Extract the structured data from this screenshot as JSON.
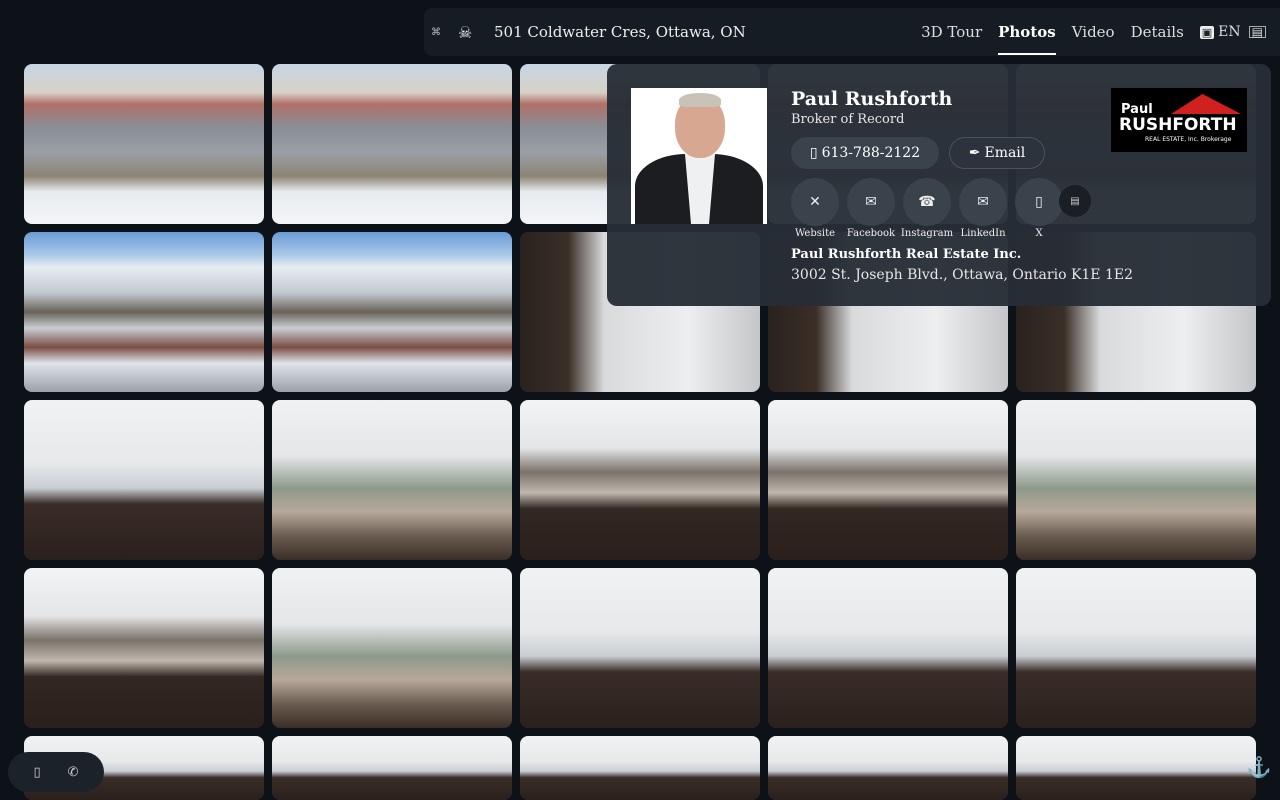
{
  "topbar": {
    "address": "501 Coldwater Cres, Ottawa, ON",
    "tabs": [
      "3D Tour",
      "Photos",
      "Video",
      "Details"
    ],
    "active_tab": "Photos",
    "language": "EN"
  },
  "gallery": {
    "rows": 5,
    "columns": 5
  },
  "agent": {
    "name": "Paul Rushforth",
    "title": "Broker of Record",
    "phone": "613-788-2122",
    "email_label": "Email",
    "socials": [
      {
        "label": "Website",
        "icon": "close-icon"
      },
      {
        "label": "Facebook",
        "icon": "facebook-icon"
      },
      {
        "label": "Instagram",
        "icon": "phone-icon"
      },
      {
        "label": "LinkedIn",
        "icon": "linkedin-icon"
      },
      {
        "label": "X",
        "icon": "mobile-icon"
      }
    ],
    "company": "Paul Rushforth Real Estate Inc.",
    "company_address": "3002 St. Joseph Blvd., Ottawa, Ontario K1E 1E2",
    "logo": {
      "line1": "Paul",
      "line2": "RUSHFORTH",
      "line3": "REAL ESTATE, Inc. Brokerage"
    }
  }
}
